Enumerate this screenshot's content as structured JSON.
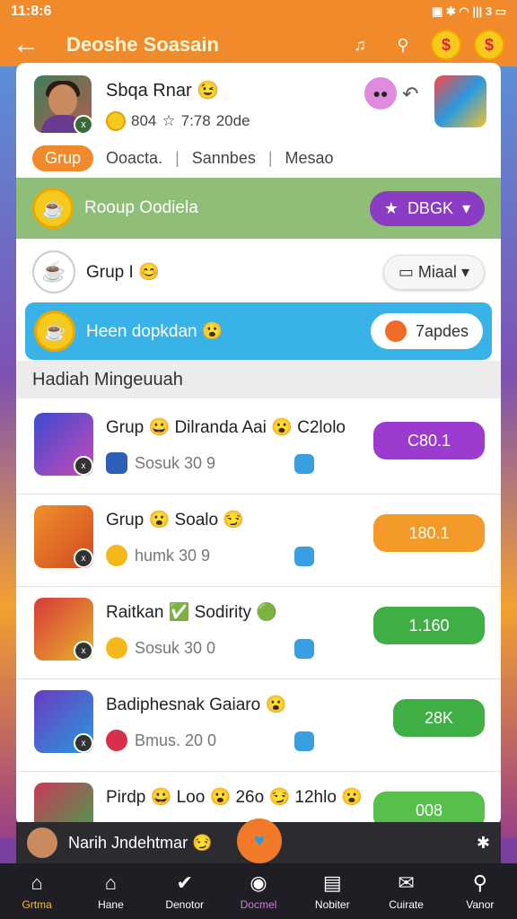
{
  "status": {
    "time": "11:8:6",
    "right": "▣ ✱ ◠ ||| 3 ▭"
  },
  "appbar": {
    "back_icon": "arrow-left-icon",
    "title": "Deoshe Soasain"
  },
  "profile": {
    "name": "Sbqa Rnar",
    "coins": "804",
    "stars": "7:78",
    "suffix": "20de"
  },
  "tabs": {
    "active": "Grup",
    "t2": "Ooacta.",
    "t3": "Sannbes",
    "t4": "Mesao"
  },
  "group_row": {
    "label": "Rooup Oodiela",
    "button": "DBGK"
  },
  "group_row2": {
    "label": "Grup I",
    "button": "Miaal"
  },
  "hot_row": {
    "label": "Heen dopkdan",
    "button": "7apdes"
  },
  "section": {
    "title": "Hadiah Mingeuuah"
  },
  "items": [
    {
      "title": "Grup 😀 Dilranda Aai 😮 C2lolo",
      "sub": "Sosuk 30 9",
      "button": "C80.1",
      "color": "#9b3bd0"
    },
    {
      "title": "Grup 😮 Soalo 😏",
      "sub": "humk 30 9",
      "button": "180.1",
      "color": "#f39a28"
    },
    {
      "title": "Raitkan ✅ Sodirity 🟢",
      "sub": "Sosuk 30 0",
      "button": "1.160",
      "color": "#3fae44"
    },
    {
      "title": "Badiphesnak Gaiaro 😮",
      "sub": "Bmus. 20 0",
      "button": "28K",
      "color": "#3fae44"
    },
    {
      "title": "Pirdp 😀 Loo 😮 26o 😏 12hlo 😮",
      "sub": "",
      "button": "008",
      "color": "#57c04a"
    }
  ],
  "now_playing": {
    "label": "Narih Jndehtmar 😏"
  },
  "nav": [
    {
      "label": "Grtma",
      "icon": "home-icon"
    },
    {
      "label": "Hane",
      "icon": "house-icon"
    },
    {
      "label": "Denotor",
      "icon": "check-icon"
    },
    {
      "label": "Docmel",
      "icon": "circle-icon"
    },
    {
      "label": "Nobiter",
      "icon": "book-icon"
    },
    {
      "label": "Cuirate",
      "icon": "chat-icon"
    },
    {
      "label": "Vanor",
      "icon": "search-icon"
    }
  ]
}
